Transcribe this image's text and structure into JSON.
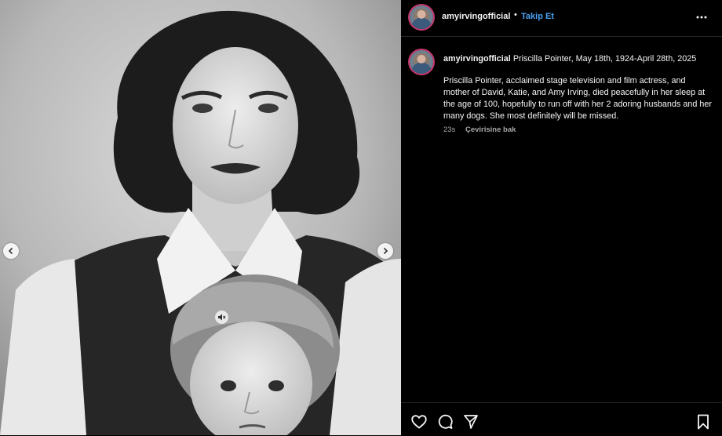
{
  "post": {
    "username": "amyirvingofficial",
    "separator": "•",
    "follow_label": "Takip Et",
    "caption_title": "Priscilla Pointer, May 18th, 1924-April 28th, 2025",
    "caption_body": "Priscilla Pointer, acclaimed stage television and film actress, and mother of David, Katie, and Amy Irving, died peacefully in her sleep at the age of 100, hopefully to run off with her 2 adoring husbands and her many dogs. She most definitely will be missed.",
    "time_ago": "23s",
    "translate_label": "Çevirisine bak"
  },
  "icons": {
    "more": "more-horizontal-icon",
    "like": "heart-icon",
    "comment": "comment-icon",
    "share": "send-icon",
    "save": "bookmark-icon",
    "prev": "chevron-left-icon",
    "next": "chevron-right-icon",
    "mute": "speaker-muted-icon"
  },
  "colors": {
    "background": "#000000",
    "link": "#4aa2f2",
    "muted_text": "#a8a8a8",
    "story_ring": "#c9386e"
  }
}
